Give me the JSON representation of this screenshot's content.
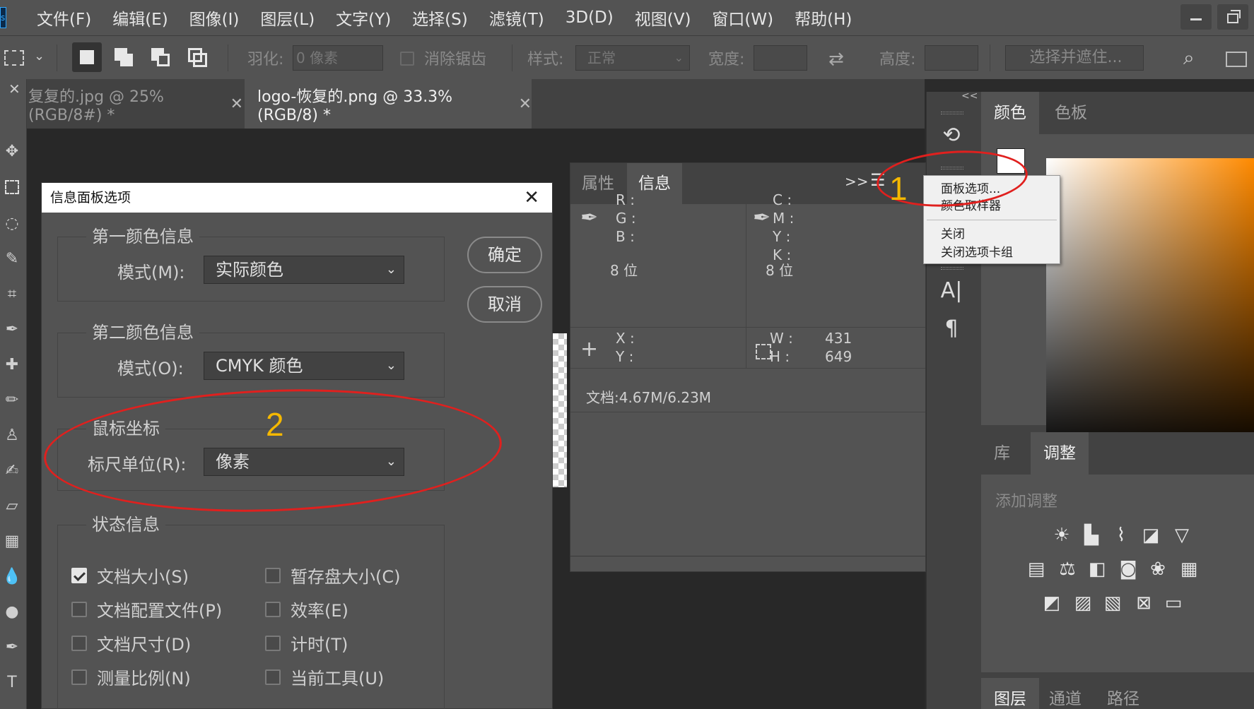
{
  "menubar": {
    "items": [
      "文件(F)",
      "编辑(E)",
      "图像(I)",
      "图层(L)",
      "文字(Y)",
      "选择(S)",
      "滤镜(T)",
      "3D(D)",
      "视图(V)",
      "窗口(W)",
      "帮助(H)"
    ]
  },
  "options": {
    "feather_label": "羽化:",
    "feather_value": "0 像素",
    "antialias_label": "消除锯齿",
    "style_label": "样式:",
    "style_value": "正常",
    "width_label": "宽度:",
    "height_label": "高度:",
    "select_mask_label": "选择并遮住..."
  },
  "doc_tabs": [
    {
      "label": "复复的.jpg @ 25%(RGB/8#) *",
      "active": false
    },
    {
      "label": "logo-恢复的.png @ 33.3%(RGB/8) *",
      "active": true
    }
  ],
  "dialog": {
    "title": "信息面板选项",
    "group1_title": "第一颜色信息",
    "group1_mode_label": "模式(M):",
    "group1_mode_value": "实际颜色",
    "group2_title": "第二颜色信息",
    "group2_mode_label": "模式(O):",
    "group2_mode_value": "CMYK 颜色",
    "group3_title": "鼠标坐标",
    "ruler_label": "标尺单位(R):",
    "ruler_value": "像素",
    "group4_title": "状态信息",
    "ok_label": "确定",
    "cancel_label": "取消",
    "checkboxes": [
      {
        "label": "文档大小(S)",
        "checked": true
      },
      {
        "label": "暂存盘大小(C)",
        "checked": false
      },
      {
        "label": "文档配置文件(P)",
        "checked": false
      },
      {
        "label": "效率(E)",
        "checked": false
      },
      {
        "label": "文档尺寸(D)",
        "checked": false
      },
      {
        "label": "计时(T)",
        "checked": false
      },
      {
        "label": "测量比例(N)",
        "checked": false
      },
      {
        "label": "当前工具(U)",
        "checked": false
      }
    ]
  },
  "info_panel": {
    "tab_properties": "属性",
    "tab_info": "信息",
    "r_label": "R :",
    "g_label": "G :",
    "b_label": "B :",
    "bits1": "8 位",
    "c_label": "C :",
    "m_label": "M :",
    "y_label": "Y :",
    "k_label": "K :",
    "bits2": "8 位",
    "x_label": "X :",
    "y_coord_label": "Y :",
    "w_label": "W :",
    "w_value": "431",
    "h_label": "H :",
    "h_value": "649",
    "doc_size": "文档:4.67M/6.23M",
    "expand_label": ">>"
  },
  "flyout_menu": {
    "items": [
      "面板选项...",
      "颜色取样器",
      "关闭",
      "关闭选项卡组"
    ]
  },
  "right_panels": {
    "color_tab": "颜色",
    "swatches_tab": "色板",
    "library_tab": "库",
    "adjustments_tab": "调整",
    "add_adjustment": "添加调整",
    "layers_tab": "图层",
    "channels_tab": "通道",
    "paths_tab": "路径",
    "collapse_label": "<<"
  },
  "annotations": {
    "one": "1",
    "two": "2"
  },
  "colors": {
    "annotation_ellipse": "#e0201e",
    "annotation_number": "#f5b800",
    "color_field_hue": "#ff8a00"
  }
}
